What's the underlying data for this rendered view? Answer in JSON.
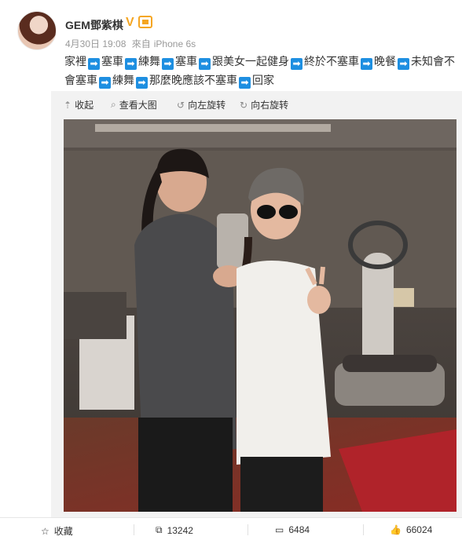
{
  "user": {
    "name": "GEM鄧紫棋",
    "verified_mark": "V"
  },
  "post": {
    "date": "4月30日 19:08",
    "source_prefix": "來自",
    "source": "iPhone 6s",
    "segments": [
      "家裡",
      "塞車",
      "練舞",
      "塞車",
      "跟美女一起健身",
      "終於不塞車",
      "晚餐",
      "未知會不會塞車",
      "練舞",
      "那麼晚應該不塞車",
      "回家"
    ],
    "arrow_glyph": "➡"
  },
  "media_toolbar": {
    "collapse": "收起",
    "view_large": "查看大图",
    "rotate_left": "向左旋转",
    "rotate_right": "向右旋转"
  },
  "actions": {
    "favorite": "收藏",
    "repost_count": "13242",
    "comment_count": "6484",
    "like_count": "66024"
  },
  "colors": {
    "accent_blue": "#1e8fe1",
    "verified_orange": "#f5a623",
    "muted_text": "#999999"
  }
}
